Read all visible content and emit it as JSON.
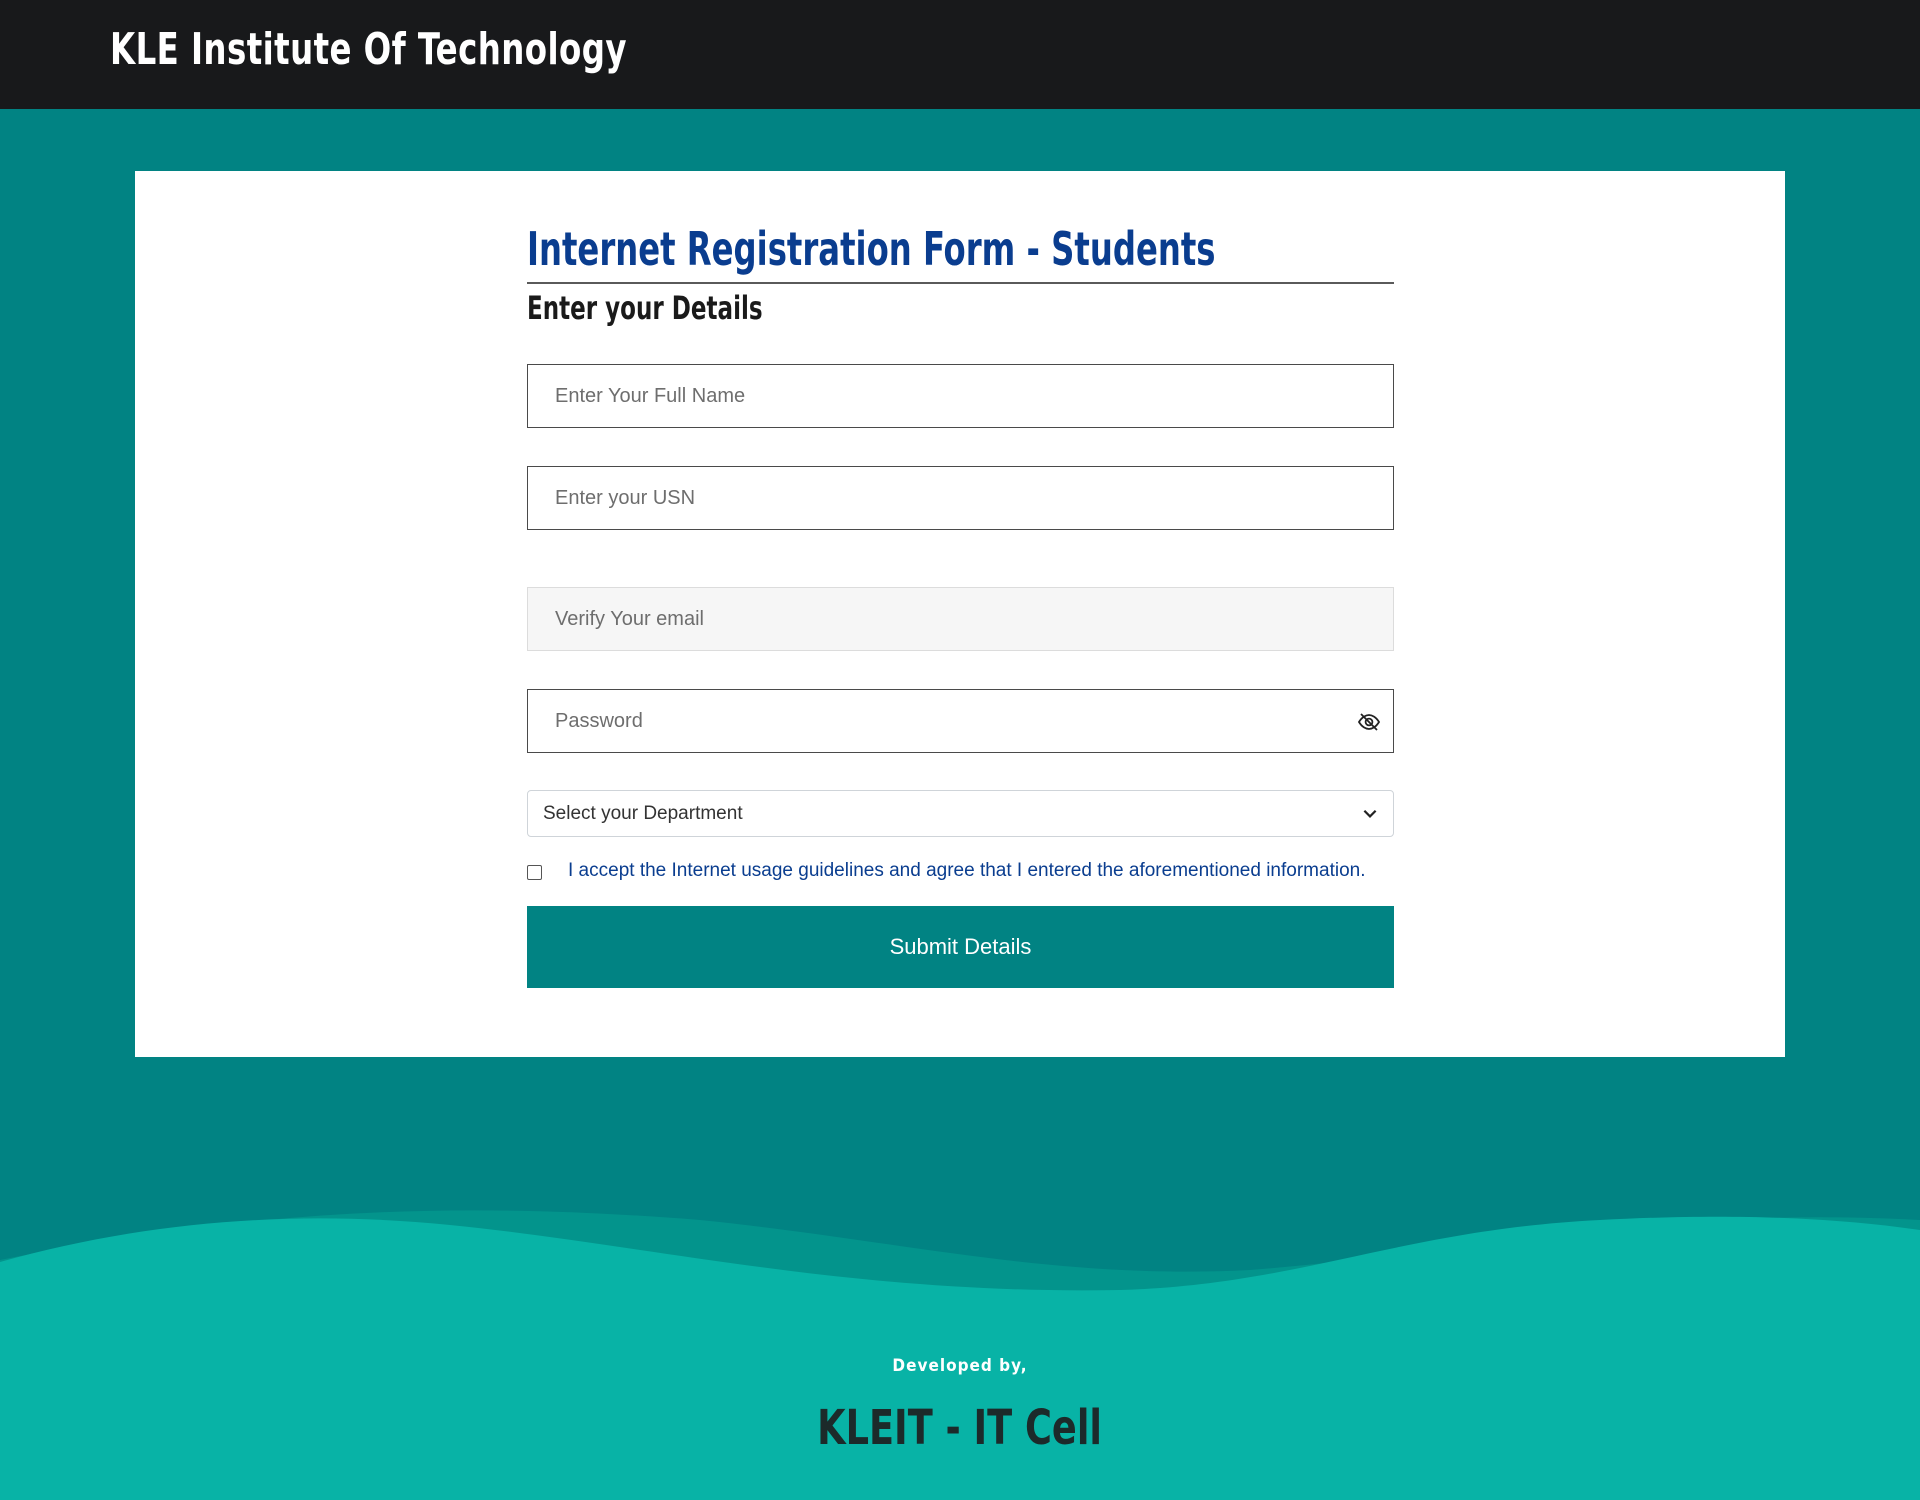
{
  "header": {
    "brand": "KLE Institute Of Technology"
  },
  "form": {
    "title": "Internet Registration Form - Students",
    "subtitle": "Enter your Details",
    "fields": {
      "name_placeholder": "Enter Your Full Name",
      "usn_placeholder": "Enter your USN",
      "email_placeholder": "Verify Your email",
      "password_placeholder": "Password"
    },
    "department_select": "Select your Department",
    "agreement": "I accept the Internet usage guidelines and agree that I entered the aforementioned information.",
    "submit_label": "Submit Details"
  },
  "footer": {
    "developed_by": "Developed by,",
    "team": "KLEIT - IT Cell"
  },
  "colors": {
    "teal": "#018383",
    "wave_light": "#08b3a6",
    "wave_mid": "#03948c",
    "header_bg": "#18191b",
    "title_blue": "#0a3d8f"
  },
  "icons": {
    "password_toggle": "eye-slash-icon",
    "select_arrow": "chevron-down-icon"
  }
}
